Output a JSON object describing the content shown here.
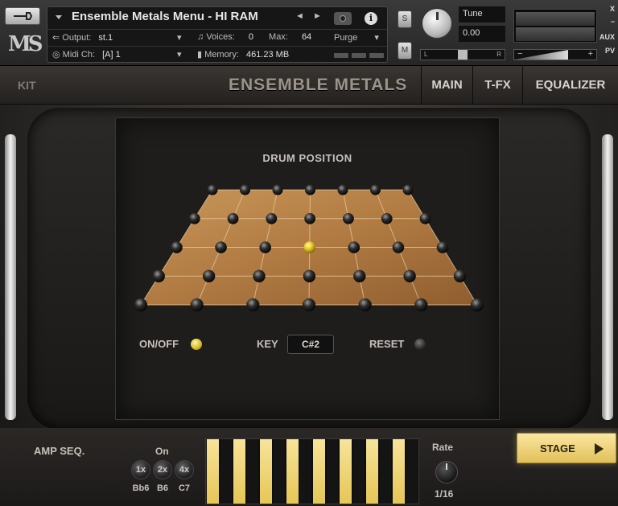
{
  "header": {
    "instrument_name": "Ensemble Metals Menu - HI RAM",
    "output_label": "Output:",
    "output_value": "st.1",
    "voices_label": "Voices:",
    "voices_value": "0",
    "max_label": "Max:",
    "max_value": "64",
    "purge_label": "Purge",
    "midi_label": "Midi Ch:",
    "midi_value": "[A] 1",
    "memory_label": "Memory:",
    "memory_value": "461.23 MB",
    "solo_label": "S",
    "mute_label": "M",
    "tune_label": "Tune",
    "tune_value": "0.00",
    "pan_left": "L",
    "pan_right": "R",
    "vol_minus": "−",
    "vol_plus": "+",
    "logo_text": "MS",
    "rail": [
      "X",
      "−",
      "AUX",
      "PV"
    ],
    "icons": [
      "wrench-icon",
      "camera-icon",
      "info-icon"
    ]
  },
  "tabs": {
    "kit": "KIT",
    "brand": "ENSEMBLE METALS",
    "main": "MAIN",
    "tfx": "T-FX",
    "eq": "EQUALIZER"
  },
  "drum_position": {
    "title": "DRUM POSITION",
    "rows": [
      7,
      7,
      7,
      7,
      7
    ],
    "selected": {
      "row": 2,
      "col": 3
    },
    "onoff_label": "ON/OFF",
    "onoff_state": true,
    "key_label": "KEY",
    "key_value": "C#2",
    "reset_label": "RESET"
  },
  "amp_seq": {
    "title": "AMP SEQ.",
    "on_label": "On",
    "multipliers": [
      "1x",
      "2x",
      "4x"
    ],
    "notes": [
      "Bb6",
      "B6",
      "C7"
    ],
    "steps": [
      1,
      0,
      1,
      0,
      1,
      0,
      1,
      0,
      1,
      0,
      1,
      0,
      1,
      0,
      1,
      0
    ],
    "rate_label": "Rate",
    "rate_value": "1/16",
    "stage_label": "STAGE"
  },
  "colors": {
    "accent_gold": "#e6c657",
    "wood": "#b9834a",
    "panel": "#1e1d1c"
  }
}
